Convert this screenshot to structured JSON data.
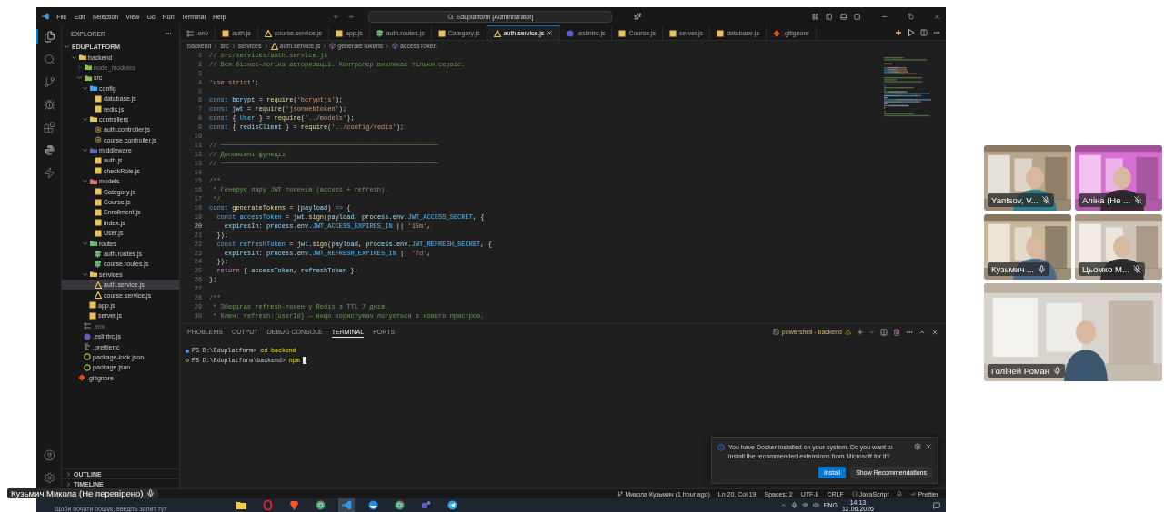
{
  "window": {
    "title": "Eduplatform [Administrator]",
    "menu": [
      "File",
      "Edit",
      "Selection",
      "View",
      "Go",
      "Run",
      "Terminal",
      "Help"
    ]
  },
  "activity_bar": {
    "top": [
      {
        "kind": "files",
        "selected": true
      },
      {
        "kind": "search",
        "selected": false
      },
      {
        "kind": "git",
        "selected": false
      },
      {
        "kind": "debug",
        "selected": false
      },
      {
        "kind": "extensions",
        "selected": false
      },
      {
        "kind": "python",
        "selected": false
      },
      {
        "kind": "bolt",
        "selected": false
      }
    ],
    "bottom": [
      {
        "kind": "account",
        "selected": false
      },
      {
        "kind": "settings",
        "selected": false
      }
    ]
  },
  "sidebar": {
    "title": "EXPLORER",
    "tree": {
      "name": "EDUPLATFORM",
      "kind": "root",
      "expanded": true,
      "selected": false,
      "dimmed": false,
      "children": [
        {
          "name": "backend",
          "kind": "folder",
          "color": "#e8c15a",
          "expanded": true,
          "selected": false,
          "dimmed": false,
          "children": [
            {
              "name": "node_modules",
              "kind": "folder",
              "color": "#8bc34a",
              "expanded": false,
              "selected": false,
              "dimmed": true
            },
            {
              "name": "src",
              "kind": "folder",
              "color": "#8bc34a",
              "expanded": true,
              "selected": false,
              "dimmed": false,
              "children": [
                {
                  "name": "config",
                  "kind": "folder",
                  "color": "#42a5f5",
                  "expanded": true,
                  "selected": false,
                  "dimmed": false,
                  "children": [
                    {
                      "name": "database.js",
                      "kind": "js",
                      "selected": false,
                      "dimmed": false
                    },
                    {
                      "name": "redis.js",
                      "kind": "js",
                      "selected": false,
                      "dimmed": false
                    }
                  ]
                },
                {
                  "name": "controllers",
                  "kind": "folder",
                  "color": "#e8c15a",
                  "expanded": true,
                  "selected": false,
                  "dimmed": false,
                  "children": [
                    {
                      "name": "auth.controller.js",
                      "kind": "gear",
                      "selected": false,
                      "dimmed": false
                    },
                    {
                      "name": "course.controller.js",
                      "kind": "gear",
                      "selected": false,
                      "dimmed": false
                    }
                  ]
                },
                {
                  "name": "middleware",
                  "kind": "folder",
                  "color": "#5c6bc0",
                  "expanded": true,
                  "selected": false,
                  "dimmed": false,
                  "children": [
                    {
                      "name": "auth.js",
                      "kind": "js",
                      "selected": false,
                      "dimmed": false
                    },
                    {
                      "name": "checkRole.js",
                      "kind": "js",
                      "selected": false,
                      "dimmed": false
                    }
                  ]
                },
                {
                  "name": "models",
                  "kind": "folder",
                  "color": "#e57373",
                  "expanded": true,
                  "selected": false,
                  "dimmed": false,
                  "children": [
                    {
                      "name": "Category.js",
                      "kind": "js",
                      "selected": false,
                      "dimmed": false
                    },
                    {
                      "name": "Course.js",
                      "kind": "js",
                      "selected": false,
                      "dimmed": false
                    },
                    {
                      "name": "Enrollment.js",
                      "kind": "js",
                      "selected": false,
                      "dimmed": false
                    },
                    {
                      "name": "index.js",
                      "kind": "js",
                      "selected": false,
                      "dimmed": false
                    },
                    {
                      "name": "User.js",
                      "kind": "js",
                      "selected": false,
                      "dimmed": false
                    }
                  ]
                },
                {
                  "name": "routes",
                  "kind": "folder",
                  "color": "#66bb6a",
                  "expanded": true,
                  "selected": false,
                  "dimmed": false,
                  "children": [
                    {
                      "name": "auth.routes.js",
                      "kind": "route",
                      "selected": false,
                      "dimmed": false
                    },
                    {
                      "name": "course.routes.js",
                      "kind": "route",
                      "selected": false,
                      "dimmed": false
                    }
                  ]
                },
                {
                  "name": "services",
                  "kind": "folder",
                  "color": "#e8c15a",
                  "expanded": true,
                  "selected": false,
                  "dimmed": false,
                  "children": [
                    {
                      "name": "auth.service.js",
                      "kind": "service",
                      "selected": true,
                      "dimmed": false
                    },
                    {
                      "name": "course.service.js",
                      "kind": "service",
                      "selected": false,
                      "dimmed": false
                    }
                  ]
                },
                {
                  "name": "app.js",
                  "kind": "js",
                  "selected": false,
                  "dimmed": false
                },
                {
                  "name": "server.js",
                  "kind": "js",
                  "selected": false,
                  "dimmed": false
                }
              ]
            },
            {
              "name": ".env",
              "kind": "env",
              "selected": false,
              "dimmed": true
            },
            {
              "name": ".eslintrc.js",
              "kind": "eslint",
              "selected": false,
              "dimmed": false
            },
            {
              "name": ".prettierrc",
              "kind": "prettier",
              "selected": false,
              "dimmed": false
            },
            {
              "name": "package-lock.json",
              "kind": "npm",
              "selected": false,
              "dimmed": false
            },
            {
              "name": "package.json",
              "kind": "npm",
              "selected": false,
              "dimmed": false
            }
          ]
        },
        {
          "name": ".gitignore",
          "kind": "git",
          "selected": false,
          "dimmed": false
        }
      ]
    },
    "sections": [
      {
        "label": "OUTLINE",
        "expanded": false
      },
      {
        "label": "TIMELINE",
        "expanded": false
      }
    ]
  },
  "tabs": [
    {
      "label": ".env",
      "kind": "env",
      "selected": false
    },
    {
      "label": "auth.js",
      "kind": "js",
      "selected": false
    },
    {
      "label": "course.service.js",
      "kind": "service",
      "selected": false
    },
    {
      "label": "app.js",
      "kind": "js",
      "selected": false
    },
    {
      "label": "auth.routes.js",
      "kind": "route",
      "selected": false
    },
    {
      "label": "Category.js",
      "kind": "js",
      "selected": false
    },
    {
      "label": "auth.service.js",
      "kind": "service",
      "selected": true
    },
    {
      "label": ".eslintrc.js",
      "kind": "eslint",
      "selected": false
    },
    {
      "label": "Course.js",
      "kind": "js",
      "selected": false
    },
    {
      "label": "server.js",
      "kind": "js",
      "selected": false
    },
    {
      "label": "database.js",
      "kind": "js",
      "selected": false
    },
    {
      "label": ".gitignore",
      "kind": "git",
      "selected": false
    }
  ],
  "breadcrumbs": [
    {
      "label": "backend",
      "kind": "folder"
    },
    {
      "label": "src",
      "kind": "folder"
    },
    {
      "label": "services",
      "kind": "folder"
    },
    {
      "label": "auth.service.js",
      "kind": "service"
    },
    {
      "label": "generateTokens",
      "kind": "symbol"
    },
    {
      "label": "accessToken",
      "kind": "symbol"
    }
  ],
  "editor": {
    "lines": [
      {
        "number": "1",
        "active": false,
        "tokens": [
          {
            "kind": "com",
            "text": "// src/services/auth.service.js"
          }
        ]
      },
      {
        "number": "2",
        "active": false,
        "tokens": [
          {
            "kind": "com",
            "text": "// Вся бізнес-логіка авторизації. Контролер викликає тільки сервіс."
          }
        ]
      },
      {
        "number": "3",
        "active": false
      },
      {
        "number": "4",
        "active": false,
        "tokens": [
          {
            "kind": "str",
            "text": "'use strict'"
          },
          {
            "kind": "punc",
            "text": ";"
          }
        ]
      },
      {
        "number": "5",
        "active": false
      },
      {
        "number": "6",
        "active": false,
        "tokens": [
          {
            "kind": "kw",
            "text": "const "
          },
          {
            "kind": "var",
            "text": "bcrypt"
          },
          {
            "kind": "punc",
            "text": " = "
          },
          {
            "kind": "fn",
            "text": "require"
          },
          {
            "kind": "punc",
            "text": "("
          },
          {
            "kind": "str",
            "text": "'bcryptjs'"
          },
          {
            "kind": "punc",
            "text": ");"
          }
        ]
      },
      {
        "number": "7",
        "active": false,
        "tokens": [
          {
            "kind": "kw",
            "text": "const "
          },
          {
            "kind": "var",
            "text": "jwt"
          },
          {
            "kind": "punc",
            "text": " = "
          },
          {
            "kind": "fn",
            "text": "require"
          },
          {
            "kind": "punc",
            "text": "("
          },
          {
            "kind": "str",
            "text": "'jsonwebtoken'"
          },
          {
            "kind": "punc",
            "text": ");"
          }
        ]
      },
      {
        "number": "8",
        "active": false,
        "tokens": [
          {
            "kind": "kw",
            "text": "const "
          },
          {
            "kind": "punc",
            "text": "{ "
          },
          {
            "kind": "const",
            "text": "User"
          },
          {
            "kind": "punc",
            "text": " } = "
          },
          {
            "kind": "fn",
            "text": "require"
          },
          {
            "kind": "punc",
            "text": "("
          },
          {
            "kind": "str",
            "text": "'../models'"
          },
          {
            "kind": "punc",
            "text": ");"
          }
        ]
      },
      {
        "number": "9",
        "active": false,
        "tokens": [
          {
            "kind": "kw",
            "text": "const "
          },
          {
            "kind": "punc",
            "text": "{ "
          },
          {
            "kind": "var",
            "text": "redisClient"
          },
          {
            "kind": "punc",
            "text": " } = "
          },
          {
            "kind": "fn",
            "text": "require"
          },
          {
            "kind": "punc",
            "text": "("
          },
          {
            "kind": "str",
            "text": "'../config/redis'"
          },
          {
            "kind": "punc",
            "text": ");"
          }
        ]
      },
      {
        "number": "10",
        "active": false
      },
      {
        "number": "11",
        "active": false,
        "tokens": [
          {
            "kind": "com",
            "text": "// ─────────────────────────────────────────────────────────"
          }
        ]
      },
      {
        "number": "12",
        "active": false,
        "tokens": [
          {
            "kind": "com",
            "text": "// Допоміжні функції"
          }
        ]
      },
      {
        "number": "13",
        "active": false,
        "tokens": [
          {
            "kind": "com",
            "text": "// ─────────────────────────────────────────────────────────"
          }
        ]
      },
      {
        "number": "14",
        "active": false
      },
      {
        "number": "15",
        "active": false,
        "tokens": [
          {
            "kind": "com",
            "text": "/**"
          }
        ]
      },
      {
        "number": "16",
        "active": false,
        "tokens": [
          {
            "kind": "com",
            "text": " * Генерує пару JWT токенів (access + refresh)."
          }
        ]
      },
      {
        "number": "17",
        "active": false,
        "tokens": [
          {
            "kind": "com",
            "text": " */"
          }
        ]
      },
      {
        "number": "18",
        "active": false,
        "tokens": [
          {
            "kind": "kw",
            "text": "const "
          },
          {
            "kind": "fn",
            "text": "generateTokens"
          },
          {
            "kind": "punc",
            "text": " = ("
          },
          {
            "kind": "var",
            "text": "payload"
          },
          {
            "kind": "punc",
            "text": ") "
          },
          {
            "kind": "kw",
            "text": "=>"
          },
          {
            "kind": "punc",
            "text": " {"
          }
        ]
      },
      {
        "number": "19",
        "active": false,
        "tokens": [
          {
            "kind": "kw",
            "text": "  const "
          },
          {
            "kind": "const",
            "text": "accessToken"
          },
          {
            "kind": "punc",
            "text": " = "
          },
          {
            "kind": "var",
            "text": "jwt"
          },
          {
            "kind": "punc",
            "text": "."
          },
          {
            "kind": "fn",
            "text": "sign"
          },
          {
            "kind": "punc",
            "text": "("
          },
          {
            "kind": "var",
            "text": "payload"
          },
          {
            "kind": "punc",
            "text": ", "
          },
          {
            "kind": "var",
            "text": "process"
          },
          {
            "kind": "punc",
            "text": "."
          },
          {
            "kind": "var",
            "text": "env"
          },
          {
            "kind": "punc",
            "text": "."
          },
          {
            "kind": "const",
            "text": "JWT_ACCESS_SECRET"
          },
          {
            "kind": "punc",
            "text": ", {"
          }
        ]
      },
      {
        "number": "20",
        "active": true,
        "tokens": [
          {
            "kind": "var",
            "text": "    expiresIn"
          },
          {
            "kind": "punc",
            "text": ": "
          },
          {
            "kind": "var",
            "text": "process"
          },
          {
            "kind": "punc",
            "text": "."
          },
          {
            "kind": "var",
            "text": "env"
          },
          {
            "kind": "punc",
            "text": "."
          },
          {
            "kind": "const",
            "text": "JWT_ACCESS_EXPIRES_IN"
          },
          {
            "kind": "punc",
            "text": " || "
          },
          {
            "kind": "str",
            "text": "'15m'"
          },
          {
            "kind": "punc",
            "text": ","
          }
        ]
      },
      {
        "number": "21",
        "active": false,
        "tokens": [
          {
            "kind": "punc",
            "text": "  });"
          }
        ]
      },
      {
        "number": "22",
        "active": false,
        "tokens": [
          {
            "kind": "kw",
            "text": "  const "
          },
          {
            "kind": "const",
            "text": "refreshToken"
          },
          {
            "kind": "punc",
            "text": " = "
          },
          {
            "kind": "var",
            "text": "jwt"
          },
          {
            "kind": "punc",
            "text": "."
          },
          {
            "kind": "fn",
            "text": "sign"
          },
          {
            "kind": "punc",
            "text": "("
          },
          {
            "kind": "var",
            "text": "payload"
          },
          {
            "kind": "punc",
            "text": ", "
          },
          {
            "kind": "var",
            "text": "process"
          },
          {
            "kind": "punc",
            "text": "."
          },
          {
            "kind": "var",
            "text": "env"
          },
          {
            "kind": "punc",
            "text": "."
          },
          {
            "kind": "const",
            "text": "JWT_REFRESH_SECRET"
          },
          {
            "kind": "punc",
            "text": ", {"
          }
        ]
      },
      {
        "number": "23",
        "active": false,
        "tokens": [
          {
            "kind": "var",
            "text": "    expiresIn"
          },
          {
            "kind": "punc",
            "text": ": "
          },
          {
            "kind": "var",
            "text": "process"
          },
          {
            "kind": "punc",
            "text": "."
          },
          {
            "kind": "var",
            "text": "env"
          },
          {
            "kind": "punc",
            "text": "."
          },
          {
            "kind": "const",
            "text": "JWT_REFRESH_EXPIRES_IN"
          },
          {
            "kind": "punc",
            "text": " || "
          },
          {
            "kind": "str",
            "text": "'7d'"
          },
          {
            "kind": "punc",
            "text": ","
          }
        ]
      },
      {
        "number": "24",
        "active": false,
        "tokens": [
          {
            "kind": "punc",
            "text": "  });"
          }
        ]
      },
      {
        "number": "25",
        "active": false,
        "tokens": [
          {
            "kind": "ctrl",
            "text": "  return"
          },
          {
            "kind": "punc",
            "text": " { "
          },
          {
            "kind": "var",
            "text": "accessToken"
          },
          {
            "kind": "punc",
            "text": ", "
          },
          {
            "kind": "var",
            "text": "refreshToken"
          },
          {
            "kind": "punc",
            "text": " };"
          }
        ]
      },
      {
        "number": "26",
        "active": false,
        "tokens": [
          {
            "kind": "punc",
            "text": "};"
          }
        ]
      },
      {
        "number": "27",
        "active": false
      },
      {
        "number": "28",
        "active": false,
        "tokens": [
          {
            "kind": "com",
            "text": "/**"
          }
        ]
      },
      {
        "number": "29",
        "active": false,
        "tokens": [
          {
            "kind": "com",
            "text": " * Зберігає refresh-токен у Redis з TTL 7 днів."
          }
        ]
      },
      {
        "number": "30",
        "active": false,
        "tokens": [
          {
            "kind": "com",
            "text": " * Ключ: refresh:{userId} — якщо користувач логується з нового пристрою,"
          }
        ]
      }
    ]
  },
  "panel": {
    "tabs": [
      {
        "label": "PROBLEMS",
        "selected": false
      },
      {
        "label": "OUTPUT",
        "selected": false
      },
      {
        "label": "DEBUG CONSOLE",
        "selected": false
      },
      {
        "label": "TERMINAL",
        "selected": true
      },
      {
        "label": "PORTS",
        "selected": false
      }
    ],
    "terminal_name": "powershell - backend",
    "terminal_lines": [
      {
        "prompt": "PS D:\\Eduplatform>",
        "command": "cd backend",
        "finished": true
      },
      {
        "prompt": "PS D:\\Eduplatform\\backend>",
        "command": "npm",
        "finished": false
      }
    ]
  },
  "notification": {
    "message": "You have Docker installed on your system. Do you want to install the recommended extensions from Microsoft for it?",
    "buttons": [
      {
        "label": "Install",
        "primary": true
      },
      {
        "label": "Show Recommendations",
        "primary": false
      }
    ]
  },
  "status_bar": {
    "items": [
      {
        "text": "Микола Кузьмич (1 hour ago)",
        "kind": "blame"
      },
      {
        "text": "Ln 20, Col 19",
        "kind": "plain"
      },
      {
        "text": "Spaces: 2",
        "kind": "plain"
      },
      {
        "text": "UTF-8",
        "kind": "plain"
      },
      {
        "text": "CRLF",
        "kind": "plain"
      },
      {
        "text": "JavaScript",
        "kind": "language"
      },
      {
        "text": "Prettier",
        "kind": "prettier"
      }
    ]
  },
  "taskbar": {
    "search_placeholder": "Щоби почати пошук, введіть запит тут",
    "apps": [
      {
        "kind": "folder",
        "selected": false
      },
      {
        "kind": "opera",
        "selected": false
      },
      {
        "kind": "brave",
        "selected": false
      },
      {
        "kind": "chrome",
        "selected": false
      },
      {
        "kind": "vscode",
        "selected": true
      },
      {
        "kind": "docker",
        "selected": false
      },
      {
        "kind": "chrome",
        "selected": false
      },
      {
        "kind": "teams",
        "selected": false
      },
      {
        "kind": "telegram",
        "selected": false
      }
    ],
    "language": "ENG",
    "time": "14:13",
    "date": "12.06.2026"
  },
  "call": {
    "participants": [
      {
        "name": "Yantsov, V...",
        "muted": true,
        "kind": "picture"
      },
      {
        "name": "Аліна (Не ...",
        "muted": true,
        "kind": "picture"
      },
      {
        "name": "Кузьмич ...",
        "muted": false,
        "kind": "picture"
      },
      {
        "name": "Цьомко М...",
        "muted": true,
        "kind": "picture"
      },
      {
        "name": "Голіней Роман",
        "muted": false,
        "kind": "picture"
      }
    ],
    "presenter": {
      "name": "Кузьмич Микола (Не перевірено)",
      "muted": false
    }
  }
}
